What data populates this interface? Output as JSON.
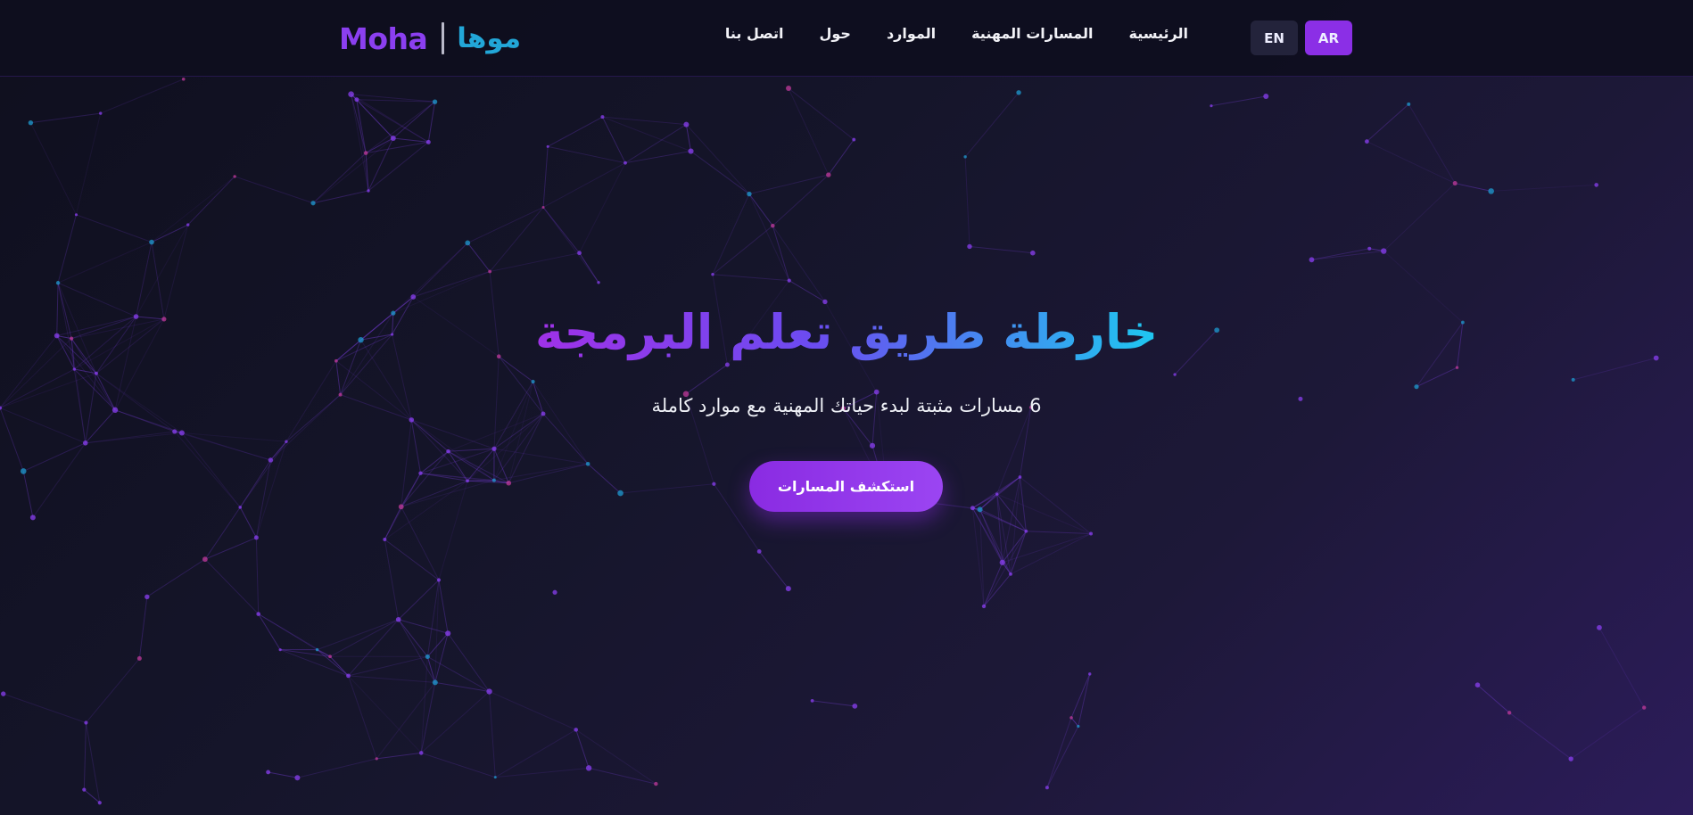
{
  "nav": {
    "logo_en": "Moha",
    "logo_ar": "موها",
    "menu": [
      {
        "label": "الرئيسية"
      },
      {
        "label": "المسارات المهنية"
      },
      {
        "label": "الموارد"
      },
      {
        "label": "حول"
      },
      {
        "label": "اتصل بنا"
      }
    ],
    "lang_en": "EN",
    "lang_ar": "AR"
  },
  "hero": {
    "title": "خارطة طريق تعلم البرمجة",
    "subtitle": "6 مسارات مثبتة لبدء حياتك المهنية مع موارد كاملة",
    "cta_label": "استكشف المسارات"
  },
  "colors": {
    "accent_purple": "#8b2fe6",
    "accent_cyan": "#1ec8f0",
    "background": "#15152a"
  }
}
